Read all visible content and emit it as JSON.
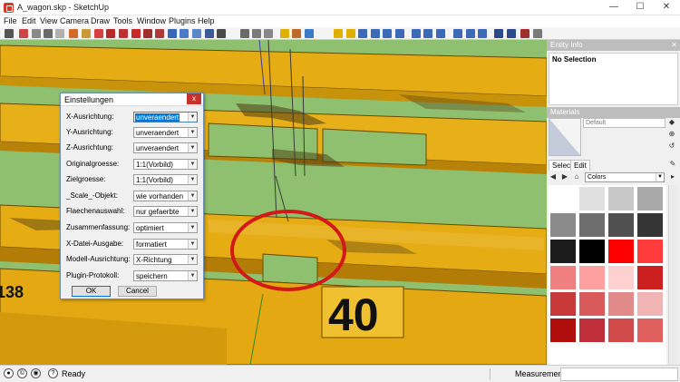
{
  "window": {
    "title": "A_wagon.skp - SketchUp",
    "minimize": "—",
    "maximize": "☐",
    "close": "✕"
  },
  "menu": [
    "File",
    "Edit",
    "View",
    "Camera",
    "Draw",
    "Tools",
    "Window",
    "Plugins",
    "Help"
  ],
  "scene": {
    "wagon_color": "#e6ac14",
    "ground_color": "#8ec06f",
    "marker_color": "#d21818",
    "number_left": "138",
    "number_right": "40"
  },
  "dialog": {
    "title": "Einstellungen",
    "close": "x",
    "rows": [
      {
        "label": "X-Ausrichtung:",
        "value": "unveraendert"
      },
      {
        "label": "Y-Ausrichtung:",
        "value": "unveraendert"
      },
      {
        "label": "Z-Ausrichtung:",
        "value": "unveraendert"
      },
      {
        "label": "Originalgroesse:",
        "value": "1:1(Vorbild)"
      },
      {
        "label": "Zielgroesse:",
        "value": "1:1(Vorbild)"
      },
      {
        "label": "_Scale_-Objekt:",
        "value": "wie vorhanden"
      },
      {
        "label": "Flaechenauswahl:",
        "value": "nur gefaerbte"
      },
      {
        "label": "Zusammenfassung:",
        "value": "optimiert"
      },
      {
        "label": "X-Datei-Ausgabe:",
        "value": "formatiert"
      },
      {
        "label": "Modell-Ausrichtung:",
        "value": "X-Richtung"
      },
      {
        "label": "Plugin-Protokoll:",
        "value": "speichern"
      }
    ],
    "ok": "OK",
    "cancel": "Cancel"
  },
  "entity_info": {
    "title": "Entity Info",
    "selection": "No Selection",
    "pin": "▼",
    "close": "✕"
  },
  "materials": {
    "title": "Materials",
    "name": "Default",
    "tab_select": "Select",
    "tab_edit": "Edit",
    "collection": "Colors",
    "swatches": [
      "#ffffff",
      "#e0e0e0",
      "#c8c8c8",
      "#a9a9a9",
      "#8a8a8a",
      "#6e6e6e",
      "#505050",
      "#353535",
      "#1c1c1c",
      "#000000",
      "#ff0000",
      "#ff3b3b",
      "#f08080",
      "#ffa0a0",
      "#ffd0d0",
      "#cc1f1f",
      "#c83a3a",
      "#d85a5a",
      "#e08a8a",
      "#f0b4b4",
      "#b00d0d",
      "#c0303a",
      "#d04a4a",
      "#e06060"
    ]
  },
  "status": {
    "text": "Ready",
    "measurements_label": "Measurements"
  }
}
